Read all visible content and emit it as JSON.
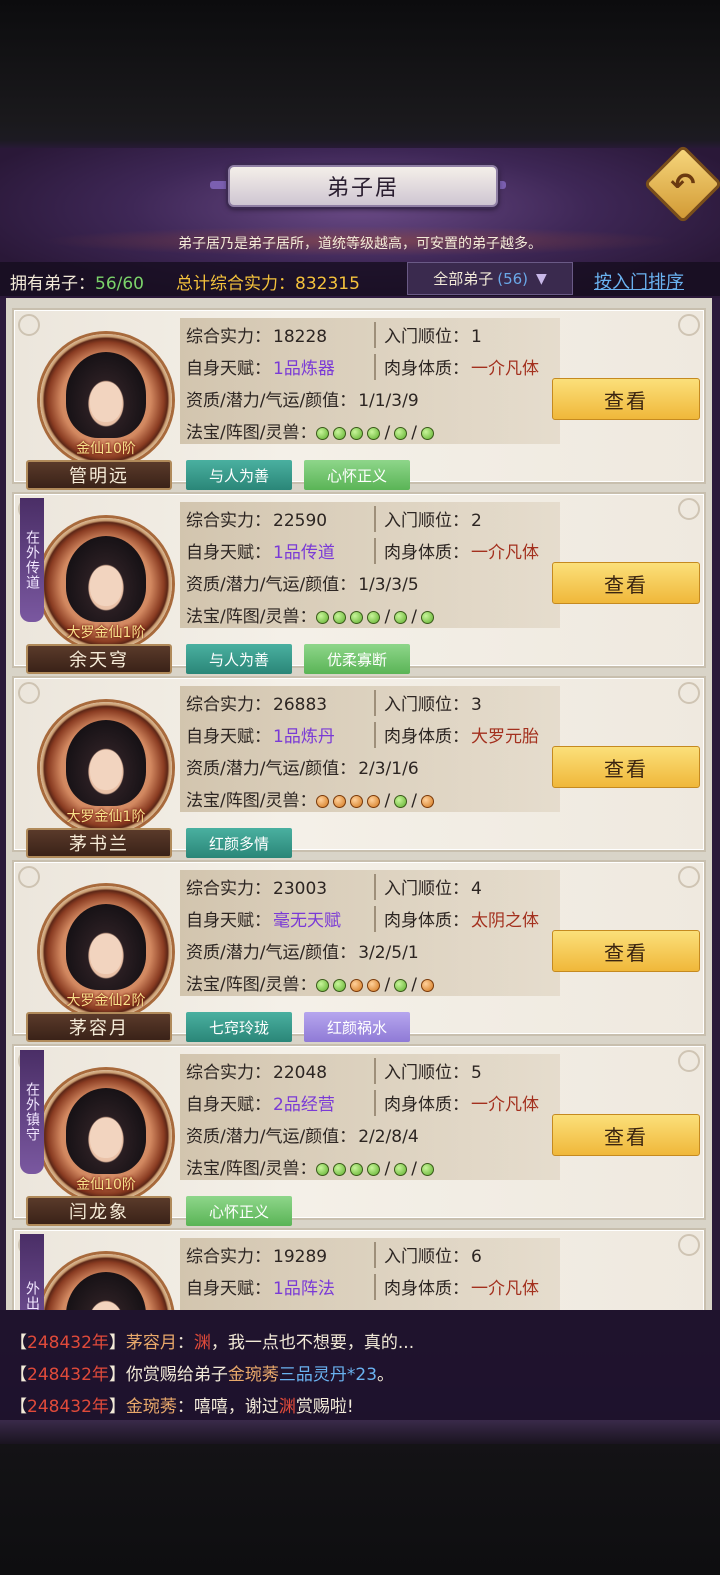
{
  "header": {
    "title": "弟子居",
    "description": "弟子居乃是弟子居所，道统等级越高，可安置的弟子越多。",
    "back_icon": "back-arrow-icon"
  },
  "stats": {
    "owned_label": "拥有弟子：",
    "owned_value": "56/60",
    "power_label": "总计综合实力：",
    "power_value": "832315",
    "filter_label": "全部弟子",
    "filter_count": "(56)",
    "sort_label": "按入门排序"
  },
  "labels": {
    "power": "综合实力：",
    "order": "入门顺位：",
    "talent": "自身天赋：",
    "body": "肉身体质：",
    "attrs": "资质/潜力/气运/颜值：",
    "treasure": "法宝/阵图/灵兽：",
    "view": "查看"
  },
  "disciples": [
    {
      "name": "管明远",
      "rank": "金仙10阶",
      "power": "18228",
      "order": "1",
      "talent": "1品炼器",
      "body": "一介凡体",
      "attrs": "1/1/3/9",
      "treasure": [
        "g",
        "g",
        "g",
        "g",
        "/",
        "g",
        "/",
        "g"
      ],
      "status": "",
      "traits": [
        {
          "text": "与人为善",
          "style": "teal"
        },
        {
          "text": "心怀正义",
          "style": "green"
        }
      ]
    },
    {
      "name": "余天穹",
      "rank": "大罗金仙1阶",
      "power": "22590",
      "order": "2",
      "talent": "1品传道",
      "body": "一介凡体",
      "attrs": "1/3/3/5",
      "treasure": [
        "g",
        "g",
        "g",
        "g",
        "/",
        "g",
        "/",
        "g"
      ],
      "status": "在外传道",
      "traits": [
        {
          "text": "与人为善",
          "style": "teal"
        },
        {
          "text": "优柔寡断",
          "style": "green"
        }
      ]
    },
    {
      "name": "茅书兰",
      "rank": "大罗金仙1阶",
      "power": "26883",
      "order": "3",
      "talent": "1品炼丹",
      "body": "大罗元胎",
      "attrs": "2/3/1/6",
      "treasure": [
        "o",
        "o",
        "o",
        "o",
        "/",
        "g",
        "/",
        "o"
      ],
      "status": "",
      "traits": [
        {
          "text": "红颜多情",
          "style": "teal"
        }
      ]
    },
    {
      "name": "茅容月",
      "rank": "大罗金仙2阶",
      "power": "23003",
      "order": "4",
      "talent": "毫无天赋",
      "body": "太阴之体",
      "attrs": "3/2/5/1",
      "treasure": [
        "g",
        "g",
        "o",
        "o",
        "/",
        "g",
        "/",
        "o"
      ],
      "status": "",
      "traits": [
        {
          "text": "七窍玲珑",
          "style": "teal"
        },
        {
          "text": "红颜祸水",
          "style": "lilac"
        }
      ]
    },
    {
      "name": "闫龙象",
      "rank": "金仙10阶",
      "power": "22048",
      "order": "5",
      "talent": "2品经营",
      "body": "一介凡体",
      "attrs": "2/2/8/4",
      "treasure": [
        "g",
        "g",
        "g",
        "g",
        "/",
        "g",
        "/",
        "g"
      ],
      "status": "在外镇守",
      "traits": [
        {
          "text": "心怀正义",
          "style": "green"
        }
      ]
    },
    {
      "name": "",
      "rank": "",
      "power": "19289",
      "order": "6",
      "talent": "1品阵法",
      "body": "一介凡体",
      "attrs": "",
      "treasure": [],
      "status": "外出",
      "traits": []
    }
  ],
  "chat": [
    {
      "year": "248432年",
      "speaker": "茅容月",
      "parts": [
        {
          "t": "：",
          "c": ""
        },
        {
          "t": "渊",
          "c": "hl"
        },
        {
          "t": "，我一点也不想要，真的...",
          "c": ""
        }
      ]
    },
    {
      "year": "248432年",
      "speaker": "",
      "parts": [
        {
          "t": "你赏赐给弟子",
          "c": ""
        },
        {
          "t": "金琬莠",
          "c": "nm"
        },
        {
          "t": "三品灵丹*23",
          "c": "it"
        },
        {
          "t": "。",
          "c": ""
        }
      ]
    },
    {
      "year": "248432年",
      "speaker": "金琬莠",
      "parts": [
        {
          "t": "：嘻嘻，谢过",
          "c": ""
        },
        {
          "t": "渊",
          "c": "hl"
        },
        {
          "t": "赏赐啦!",
          "c": ""
        }
      ]
    }
  ],
  "colors": {
    "accent_gold": "#f4c23c",
    "talent_purple": "#7a3ad6",
    "body_red": "#a3301e",
    "owned_green": "#7bd36a",
    "chat_year_red": "#e04a3a"
  }
}
